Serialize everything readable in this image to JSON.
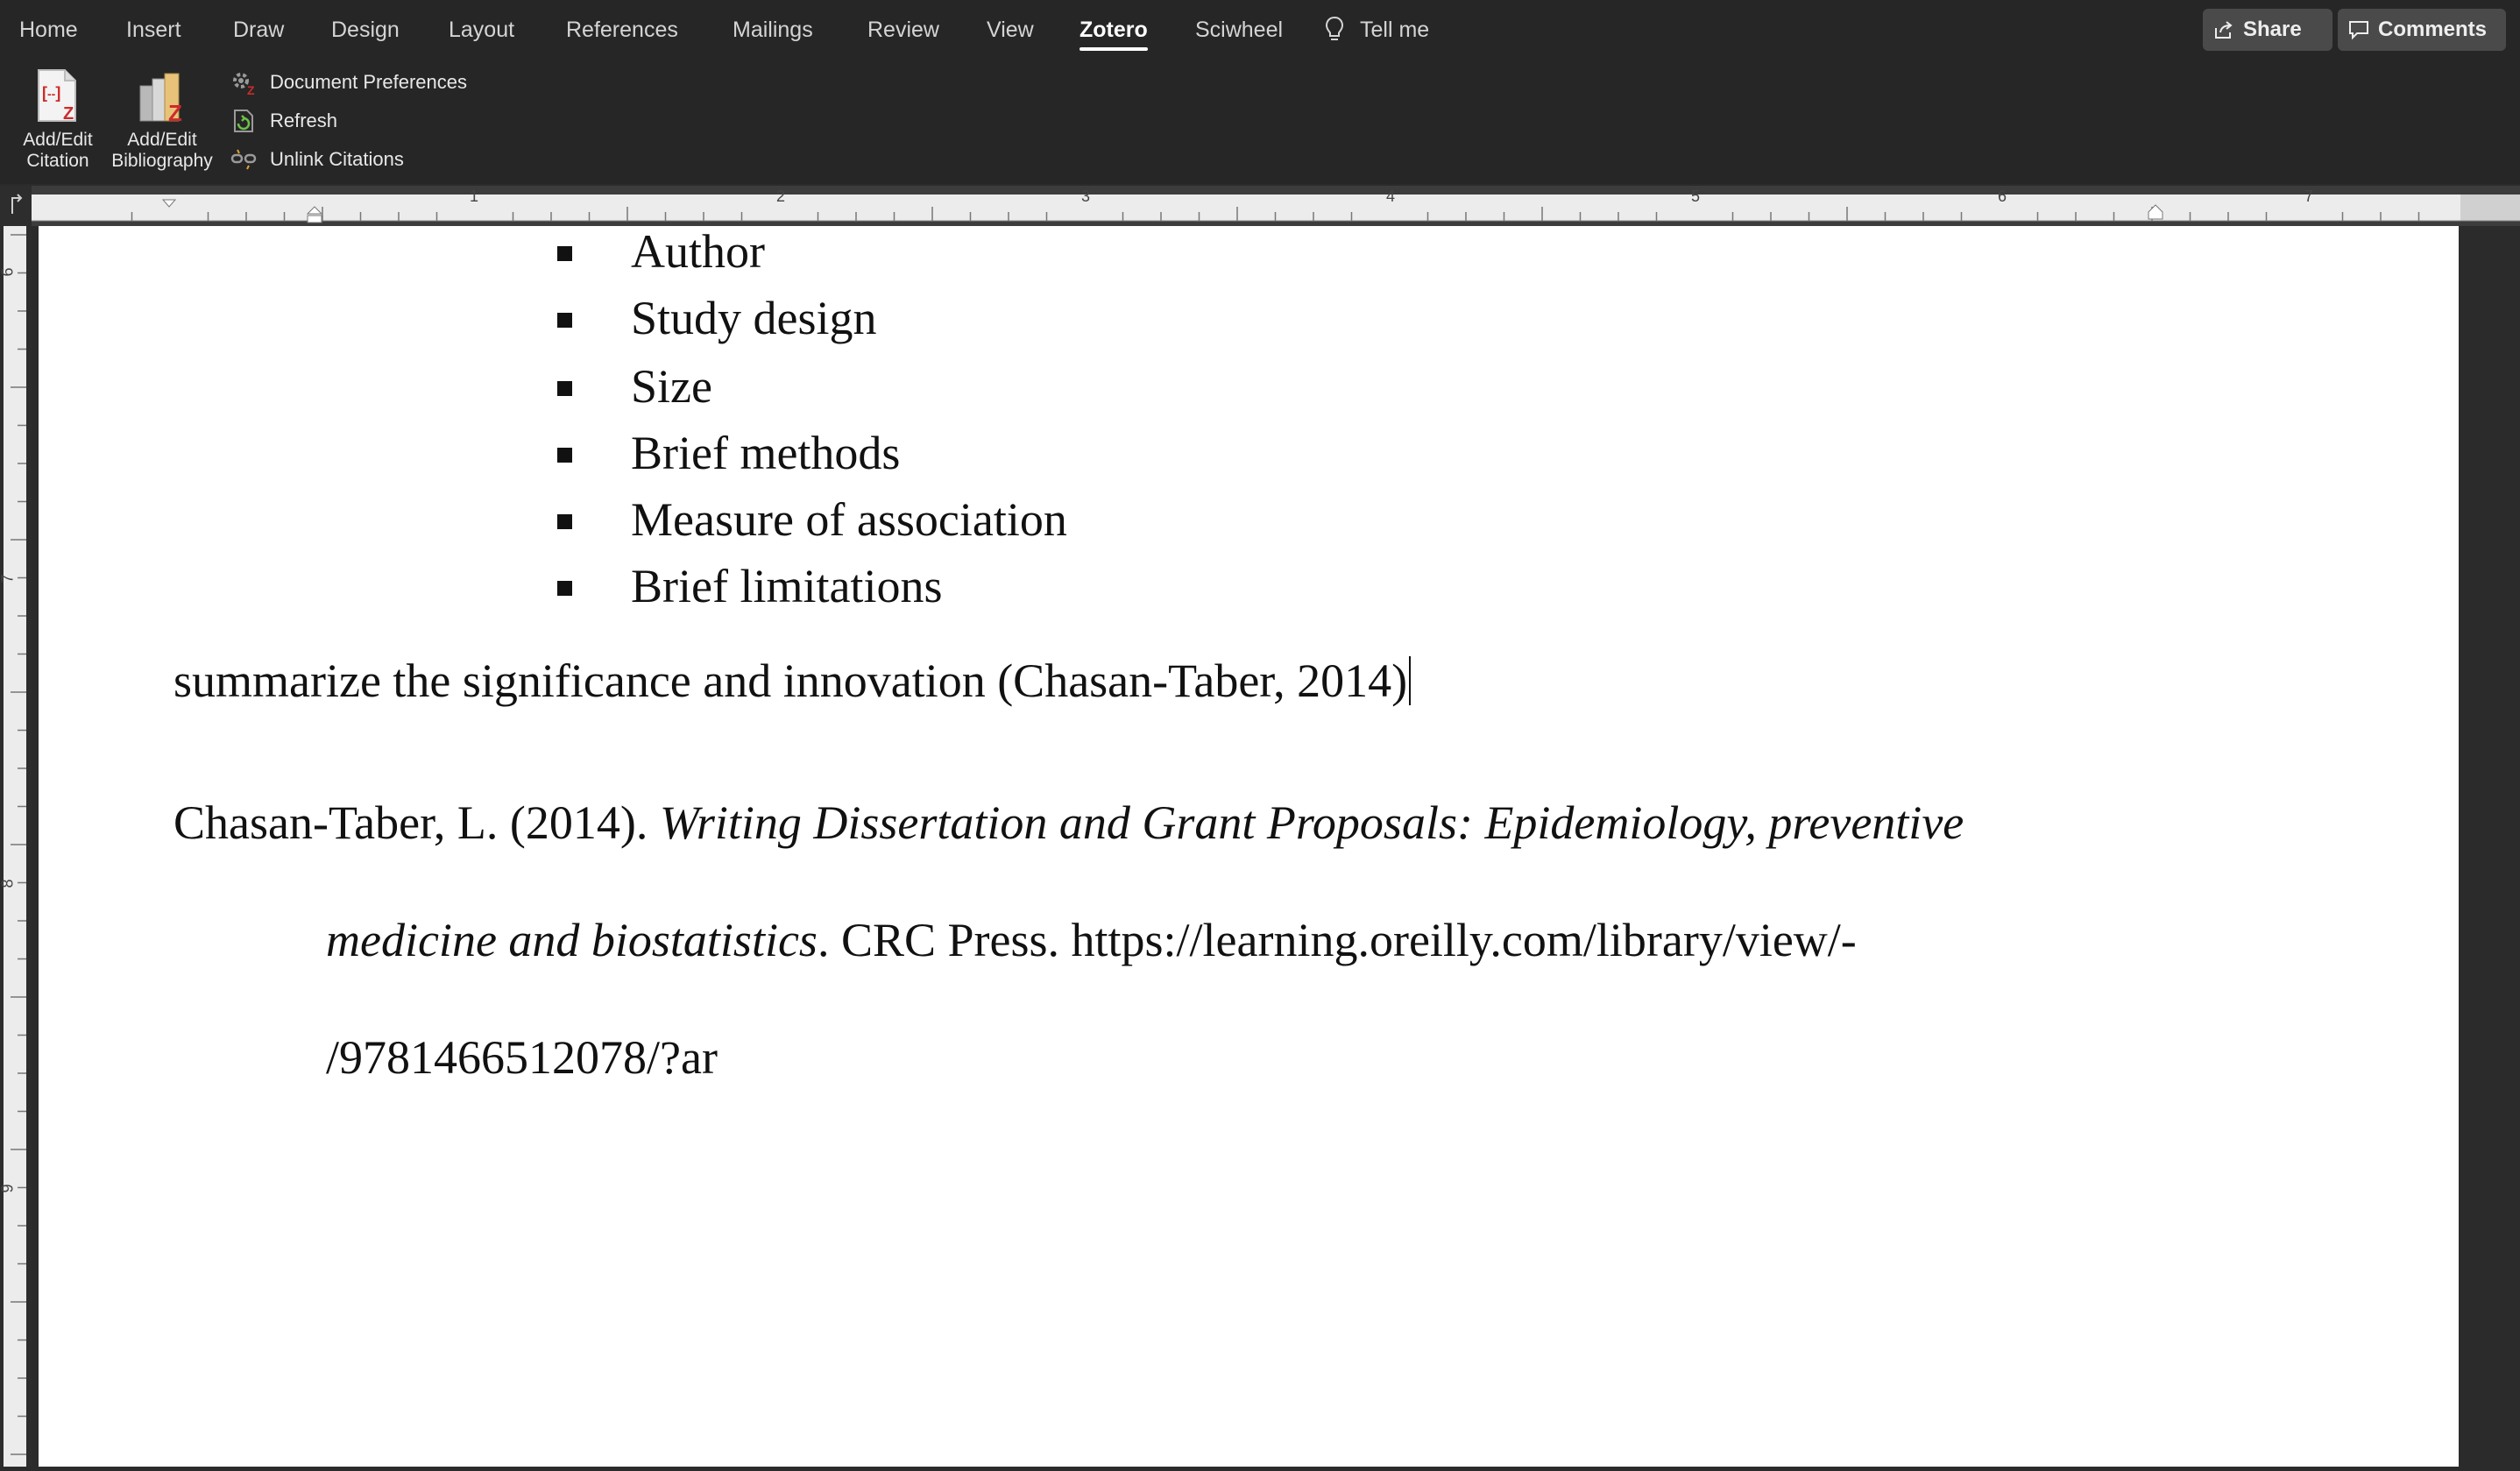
{
  "ribbon_tabs": [
    {
      "label": "Home"
    },
    {
      "label": "Insert"
    },
    {
      "label": "Draw"
    },
    {
      "label": "Design"
    },
    {
      "label": "Layout"
    },
    {
      "label": "References"
    },
    {
      "label": "Mailings"
    },
    {
      "label": "Review"
    },
    {
      "label": "View"
    },
    {
      "label": "Zotero",
      "active": true
    },
    {
      "label": "Sciwheel"
    }
  ],
  "tell_me": "Tell me",
  "toolbar": {
    "share_label": "Share",
    "comments_label": "Comments"
  },
  "zotero": {
    "add_edit_citation": "Add/Edit\nCitation",
    "add_edit_bibliography": "Add/Edit\nBibliography",
    "document_preferences": "Document Preferences",
    "refresh": "Refresh",
    "unlink_citations": "Unlink Citations"
  },
  "ruler": {
    "h_numbers": [
      "1",
      "2",
      "3",
      "4",
      "5",
      "6",
      "7"
    ],
    "v_numbers": [
      "6",
      "7",
      "8",
      "9"
    ]
  },
  "document": {
    "bullets": [
      "Author",
      "Study design",
      "Size",
      "Brief methods",
      "Measure of association",
      "Brief limitations"
    ],
    "paragraph": "summarize the significance and innovation (Chasan-Taber, 2014)",
    "reference": {
      "author_year": "Chasan-Taber, L. (2014). ",
      "title_part1": "Writing Dissertation and Grant Proposals: Epidemiology, preventive",
      "title_part2": "medicine and biostatistics",
      "publisher_url": ". CRC Press. https://learning.oreilly.com/library/view/-",
      "url_tail": "/9781466512078/?ar"
    }
  },
  "colors": {
    "chrome": "#262626",
    "ruler": "#3c3c3c",
    "page": "#ffffff",
    "zotero_red": "#cc2b2b"
  }
}
